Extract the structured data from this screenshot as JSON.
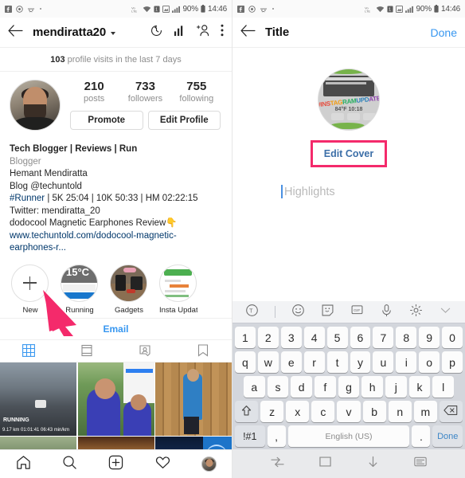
{
  "status_bar": {
    "time": "14:46",
    "battery_percent": "90%",
    "left_icons": [
      "facebook-icon",
      "circled-icon",
      "emoji-face-icon",
      "dot-icon"
    ],
    "right_icons": [
      "volte-icon",
      "wifi-icon",
      "sim-icon",
      "screenshot-icon",
      "signal-icon"
    ]
  },
  "left_panel": {
    "appbar": {
      "back_icon": "back-arrow-icon",
      "username": "mendiratta20",
      "dropdown_icon": "chevron-down-icon",
      "actions": [
        "archive-clock-icon",
        "insights-bar-chart-icon",
        "add-person-icon",
        "overflow-menu-icon"
      ]
    },
    "visits": {
      "count": "103",
      "text": "profile visits in the last 7 days"
    },
    "stats": [
      {
        "number": "210",
        "label": "posts"
      },
      {
        "number": "733",
        "label": "followers"
      },
      {
        "number": "755",
        "label": "following"
      }
    ],
    "buttons": {
      "promote": "Promote",
      "edit_profile": "Edit Profile"
    },
    "bio": {
      "name": "Tech Blogger | Reviews | Run",
      "category": "Blogger",
      "line1": "Hemant Mendiratta",
      "line2": "Blog @techuntold",
      "line3_tag": "#Runner",
      "line3_rest": " | 5K 25:04 | 10K 50:33 | HM 02:22:15",
      "line4": "Twitter: mendiratta_20",
      "line5": "dodocool Magnetic Earphones Review",
      "link": "www.techuntold.com/dodocool-magnetic-earphones-r..."
    },
    "highlights": [
      {
        "label": "New",
        "icon": "plus-icon"
      },
      {
        "label": "Running",
        "icon": "highlight-cover-running"
      },
      {
        "label": "Gadgets",
        "icon": "highlight-cover-gadgets"
      },
      {
        "label": "Insta Updat...",
        "icon": "highlight-cover-insta"
      }
    ],
    "email_button": "Email",
    "tabs": [
      "grid-tab-icon",
      "list-tab-icon",
      "tagged-tab-icon",
      "saved-tab-icon"
    ],
    "grid_overlay": {
      "running_label": "RUNNING",
      "running_stats": "9.17 km   01:01:41   06:43 min/km"
    },
    "bottom_nav": [
      "home-icon",
      "search-icon",
      "add-post-icon",
      "activity-heart-icon",
      "profile-avatar-icon"
    ]
  },
  "right_panel": {
    "appbar": {
      "back_icon": "back-arrow-icon",
      "title": "Title",
      "done": "Done"
    },
    "edit_cover_button": "Edit Cover",
    "highlights_input_placeholder": "Highlights",
    "keyboard": {
      "toolbar_icons": [
        "translate-icon",
        "emoji-icon",
        "sticker-icon",
        "gif-icon",
        "microphone-icon",
        "settings-gear-icon",
        "collapse-chevron-icon"
      ],
      "row_numbers": [
        "1",
        "2",
        "3",
        "4",
        "5",
        "6",
        "7",
        "8",
        "9",
        "0"
      ],
      "row_top": [
        "q",
        "w",
        "e",
        "r",
        "t",
        "y",
        "u",
        "i",
        "o",
        "p"
      ],
      "row_mid": [
        "a",
        "s",
        "d",
        "f",
        "g",
        "h",
        "j",
        "k",
        "l"
      ],
      "row_bot_letters": [
        "z",
        "x",
        "c",
        "v",
        "b",
        "n",
        "m"
      ],
      "shift_icon": "shift-arrow-icon",
      "backspace_icon": "backspace-icon",
      "symbols_key": "!#1",
      "comma_key": ",",
      "space_key": "English (US)",
      "period_key": ".",
      "done_key": "Done"
    },
    "android_nav": [
      "recents-icon",
      "home-square-icon",
      "hide-keyboard-down-icon",
      "keyboard-switch-icon"
    ]
  },
  "annotations": {
    "arrow_color": "#f42a6b",
    "highlight_box_color": "#f42a6b"
  }
}
